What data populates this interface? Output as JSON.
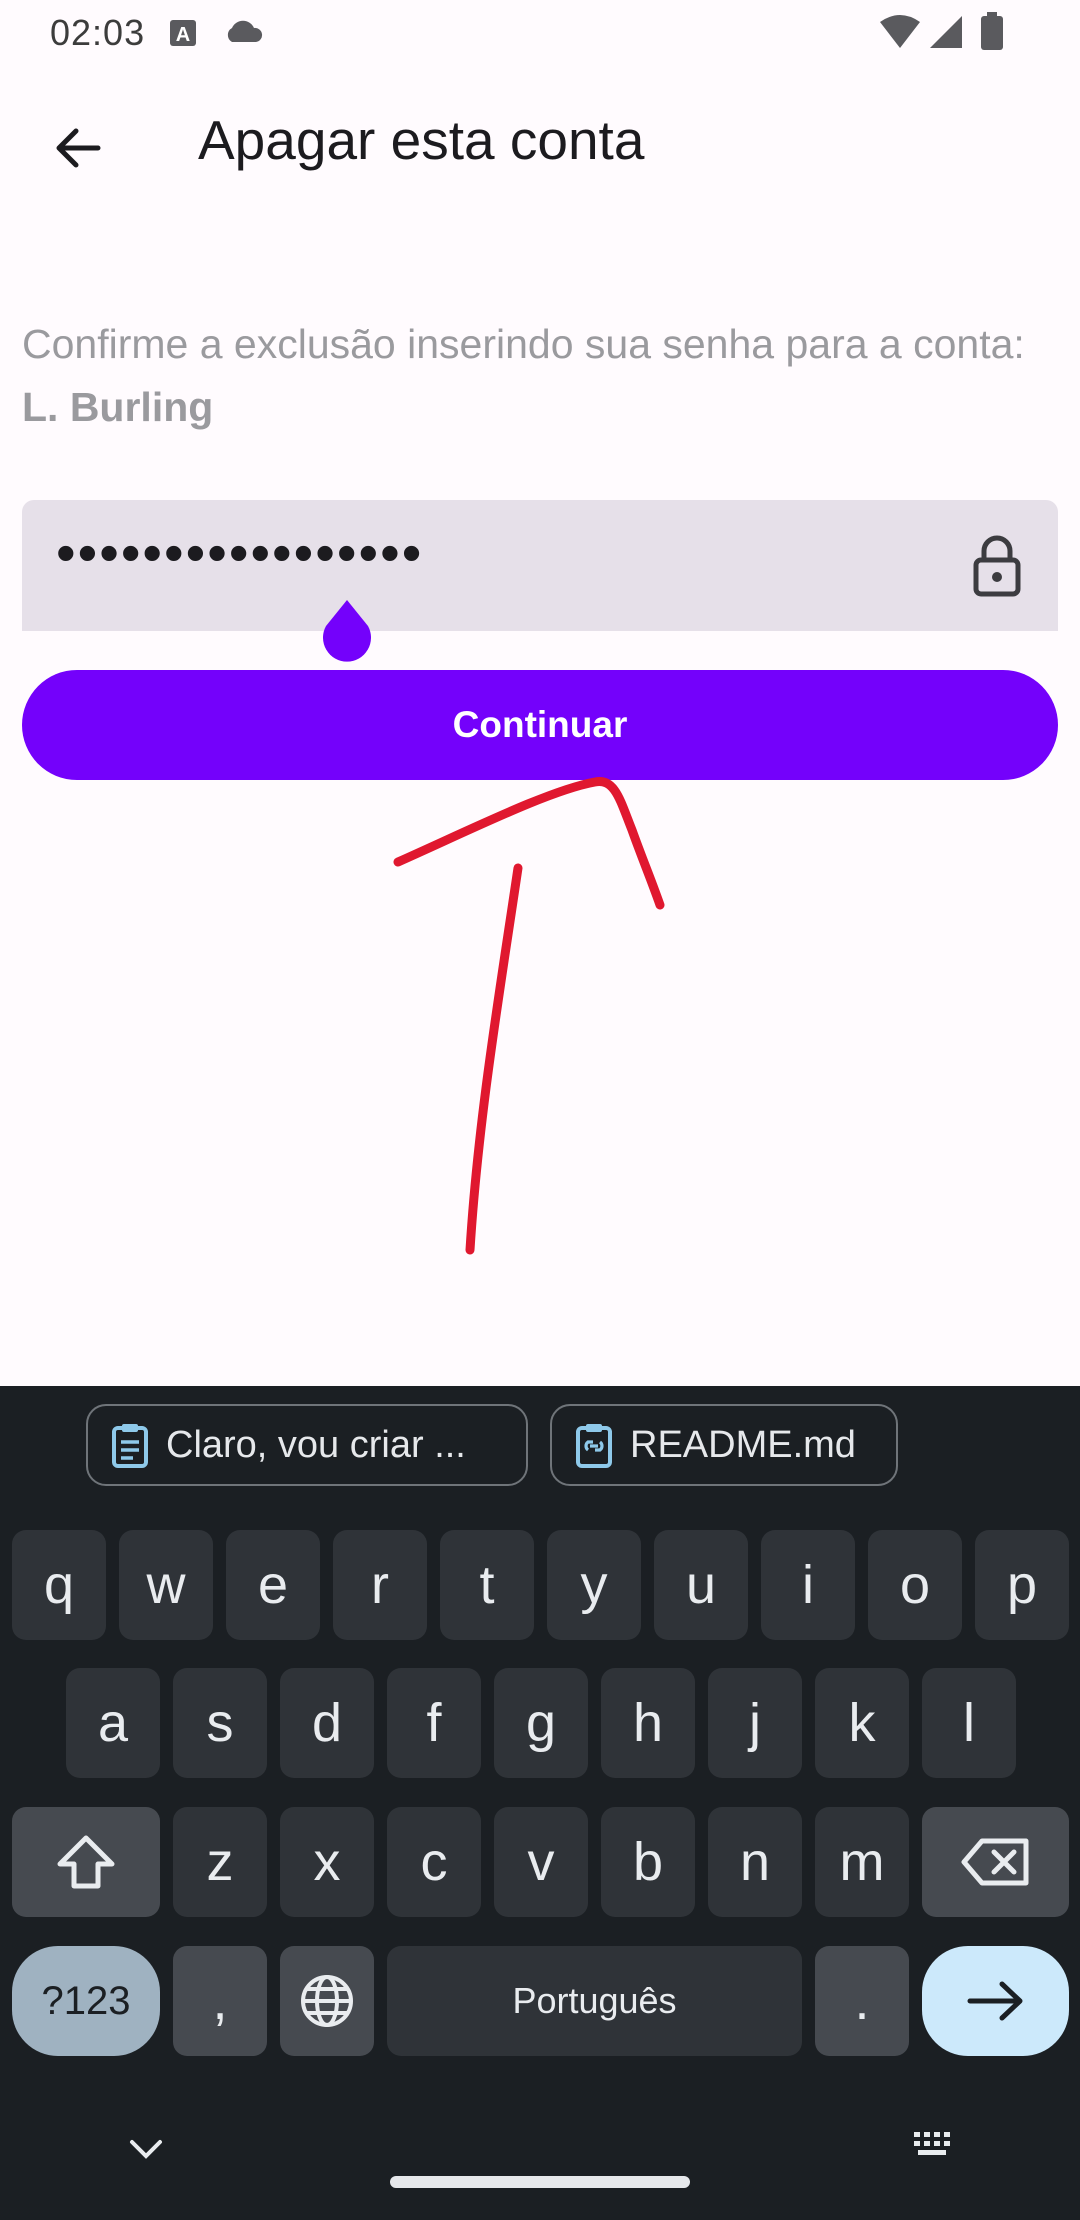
{
  "status_bar": {
    "time": "02:03"
  },
  "app_bar": {
    "title": "Apagar esta conta"
  },
  "confirm": {
    "prefix": "Confirme a exclusão inserindo sua senha para a conta: ",
    "account": "L. Burling"
  },
  "password": {
    "masked_value": "•••••••••••••••••"
  },
  "continue_button": {
    "label": "Continuar"
  },
  "keyboard": {
    "suggestions": [
      "Claro, vou criar ...",
      "README.md"
    ],
    "row1": [
      "q",
      "w",
      "e",
      "r",
      "t",
      "y",
      "u",
      "i",
      "o",
      "p"
    ],
    "row2": [
      "a",
      "s",
      "d",
      "f",
      "g",
      "h",
      "j",
      "k",
      "l"
    ],
    "row3": [
      "z",
      "x",
      "c",
      "v",
      "b",
      "n",
      "m"
    ],
    "symbols_label": "?123",
    "comma": ",",
    "space_label": "Português",
    "period": "."
  },
  "colors": {
    "accent": "#7401fb",
    "annotation": "#e0182f"
  }
}
